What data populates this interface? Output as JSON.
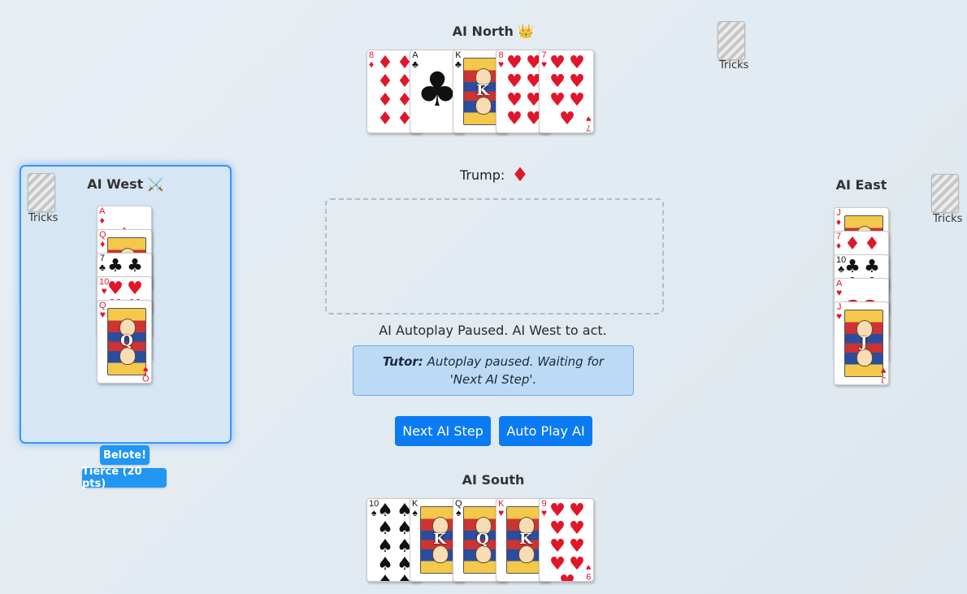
{
  "north": {
    "name": "AI North 👑",
    "cards": [
      {
        "rank": "8",
        "suit": "♦",
        "color": "red"
      },
      {
        "rank": "A",
        "suit": "♣",
        "color": "black"
      },
      {
        "rank": "K",
        "suit": "♣",
        "color": "black"
      },
      {
        "rank": "8",
        "suit": "♥",
        "color": "red"
      },
      {
        "rank": "7",
        "suit": "♥",
        "color": "red"
      }
    ]
  },
  "west": {
    "name": "AI West ⚔️",
    "tricks_label": "Tricks",
    "cards": [
      {
        "rank": "A",
        "suit": "♦",
        "color": "red"
      },
      {
        "rank": "Q",
        "suit": "♦",
        "color": "red"
      },
      {
        "rank": "7",
        "suit": "♣",
        "color": "black"
      },
      {
        "rank": "10",
        "suit": "♥",
        "color": "red"
      },
      {
        "rank": "Q",
        "suit": "♥",
        "color": "red"
      }
    ],
    "announcements": [
      "Belote!",
      "Tierce (20 pts)"
    ]
  },
  "east": {
    "name": "AI East",
    "tricks_label": "Tricks",
    "cards": [
      {
        "rank": "J",
        "suit": "♦",
        "color": "red"
      },
      {
        "rank": "7",
        "suit": "♦",
        "color": "red"
      },
      {
        "rank": "10",
        "suit": "♣",
        "color": "black"
      },
      {
        "rank": "A",
        "suit": "♥",
        "color": "red"
      },
      {
        "rank": "J",
        "suit": "♥",
        "color": "red"
      }
    ]
  },
  "north_tricks_label": "Tricks",
  "south": {
    "name": "AI South",
    "cards": [
      {
        "rank": "10",
        "suit": "♠",
        "color": "black"
      },
      {
        "rank": "K",
        "suit": "♠",
        "color": "black"
      },
      {
        "rank": "Q",
        "suit": "♠",
        "color": "black"
      },
      {
        "rank": "K",
        "suit": "♥",
        "color": "red"
      },
      {
        "rank": "9",
        "suit": "♥",
        "color": "red"
      }
    ]
  },
  "trump": {
    "label": "Trump:",
    "suit": "♦",
    "color": "#e0162b"
  },
  "status": "AI Autoplay Paused. AI West to act.",
  "tutor": {
    "prefix": "Tutor:",
    "message": "Autoplay paused. Waiting for 'Next AI Step'."
  },
  "buttons": {
    "next_step": "Next AI Step",
    "auto_play": "Auto Play AI"
  },
  "colors": {
    "accent": "#0a7bf2",
    "highlight_border": "#3b97f2",
    "red_suit": "#e0162b"
  }
}
